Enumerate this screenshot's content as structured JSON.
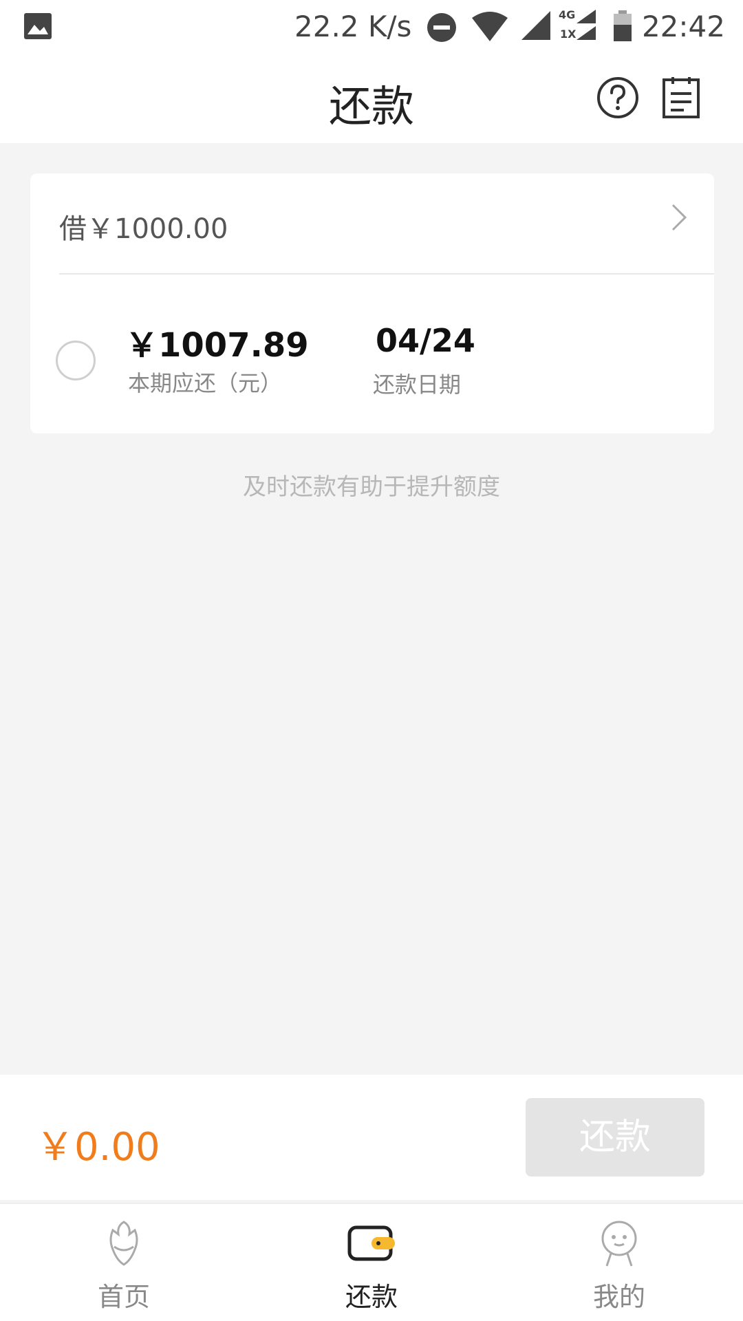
{
  "status_bar": {
    "network_speed": "22.2 K/s",
    "time": "22:42",
    "network_type_top": "4G",
    "network_type_bottom": "1X"
  },
  "header": {
    "title": "还款"
  },
  "loan": {
    "label": "借￥1000.00",
    "amount_due": "￥1007.89",
    "amount_due_label": "本期应还（元）",
    "due_date": "04/24",
    "due_date_label": "还款日期"
  },
  "tip": "及时还款有助于提升额度",
  "pay_bar": {
    "total": "￥0.00",
    "button_label": "还款"
  },
  "tabs": [
    {
      "label": "首页",
      "icon": "home-icon",
      "active": false
    },
    {
      "label": "还款",
      "icon": "wallet-icon",
      "active": true
    },
    {
      "label": "我的",
      "icon": "profile-icon",
      "active": false
    }
  ],
  "colors": {
    "accent": "#f07c1c",
    "background": "#f4f4f4",
    "disabled_button": "#e4e4e4",
    "active_tab_accent": "#f5b82e"
  }
}
